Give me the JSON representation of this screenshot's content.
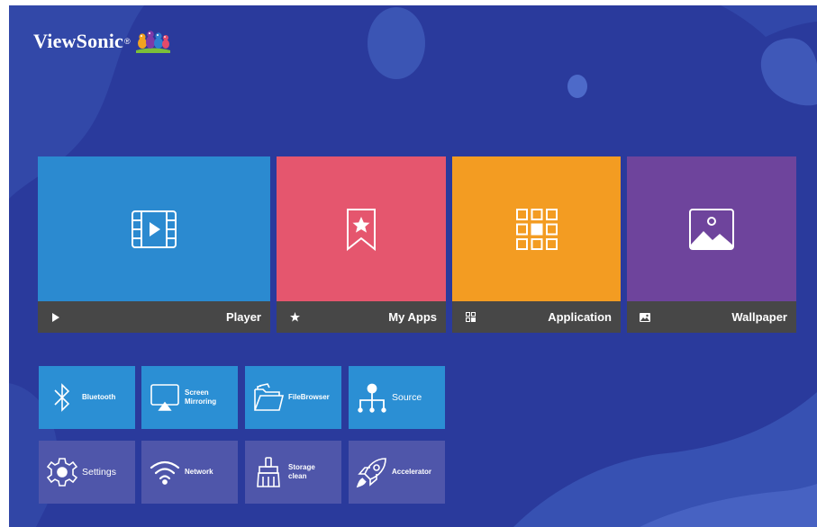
{
  "brand": {
    "name": "ViewSonic",
    "mark": "®"
  },
  "main_tiles": [
    {
      "id": "player",
      "label": "Player",
      "icon": "film-play-icon",
      "color": "#2b8ad0"
    },
    {
      "id": "my-apps",
      "label": "My Apps",
      "icon": "bookmark-star-icon",
      "color": "#e5566e"
    },
    {
      "id": "application",
      "label": "Application",
      "icon": "app-grid-icon",
      "color": "#f39c22"
    },
    {
      "id": "wallpaper",
      "label": "Wallpaper",
      "icon": "image-icon",
      "color": "#6e449c"
    }
  ],
  "shortcuts_row1": [
    {
      "id": "bluetooth",
      "label": "Bluetooth",
      "icon": "bluetooth-icon"
    },
    {
      "id": "screen-mirroring",
      "label": "Screen\nMirroring",
      "icon": "screen-mirroring-icon"
    },
    {
      "id": "filebrowser",
      "label": "FileBrowser",
      "icon": "folder-icon"
    },
    {
      "id": "source",
      "label": "Source",
      "icon": "source-icon"
    }
  ],
  "shortcuts_row2": [
    {
      "id": "settings",
      "label": "Settings",
      "icon": "gear-icon"
    },
    {
      "id": "network",
      "label": "Network",
      "icon": "wifi-icon"
    },
    {
      "id": "storage-clean",
      "label": "Storage\nclean",
      "icon": "broom-icon"
    },
    {
      "id": "accelerator",
      "label": "Accelerator",
      "icon": "rocket-icon"
    }
  ],
  "colors": {
    "background": "#2a3a9c",
    "label_bar": "#474747",
    "shortcut_blue": "#2b8fd4",
    "shortcut_purple": "#4f56aa"
  }
}
